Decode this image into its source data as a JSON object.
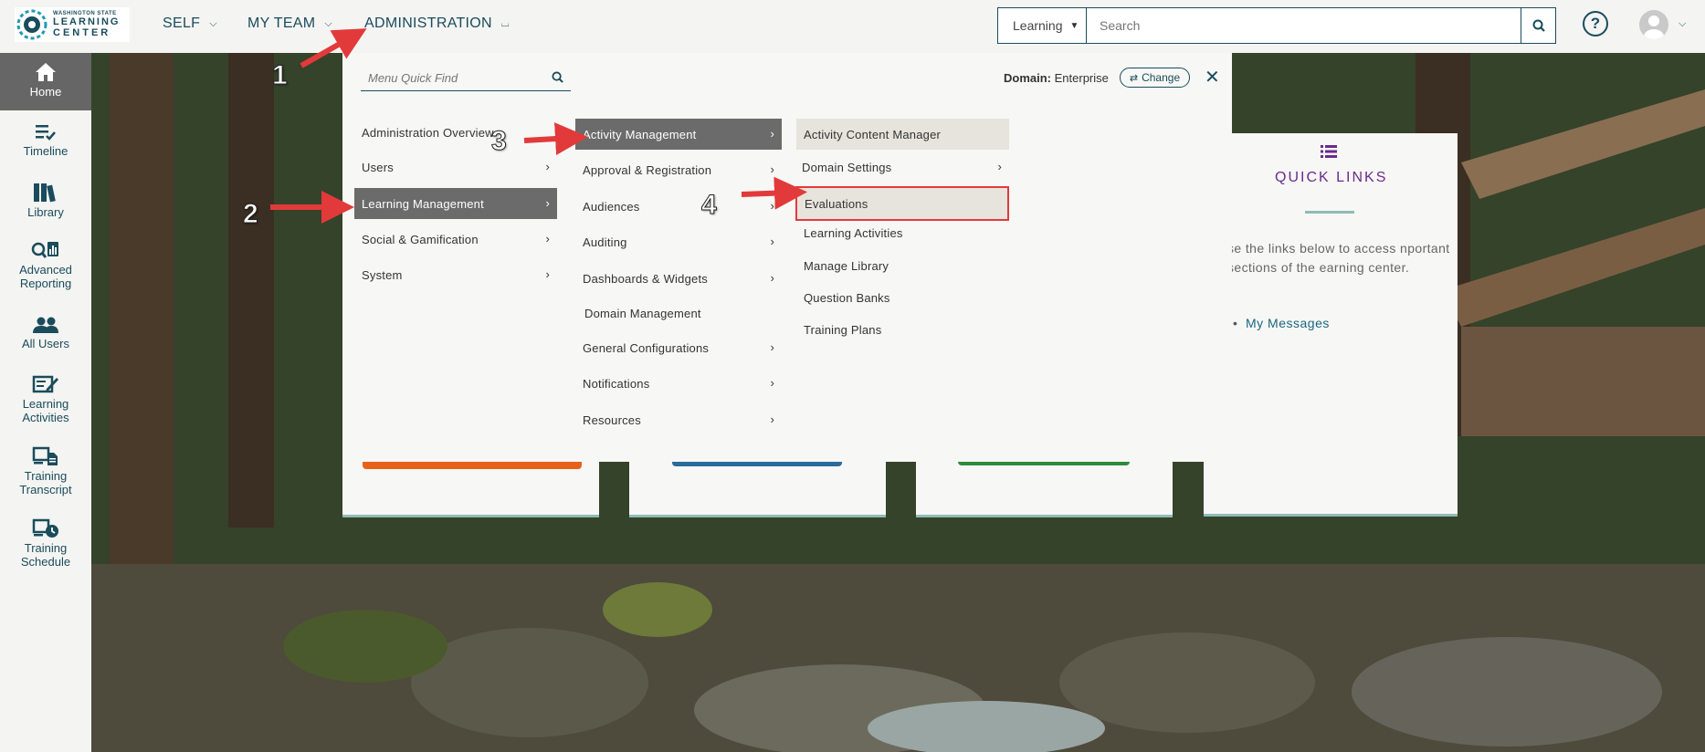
{
  "logo": {
    "line1": "WASHINGTON STATE",
    "line2": "LEARNING",
    "line3": "CENTER"
  },
  "topnav": {
    "self": "SELF",
    "my_team": "MY TEAM",
    "administration": "ADMINISTRATION"
  },
  "search": {
    "type": "Learning",
    "placeholder": "Search"
  },
  "sidebar": {
    "items": [
      {
        "label": "Home",
        "icon": "home-icon"
      },
      {
        "label": "Timeline",
        "icon": "timeline-icon"
      },
      {
        "label": "Library",
        "icon": "library-icon"
      },
      {
        "label": "Advanced Reporting",
        "icon": "reporting-icon"
      },
      {
        "label": "All Users",
        "icon": "users-icon"
      },
      {
        "label": "Learning Activities",
        "icon": "activities-icon"
      },
      {
        "label": "Training Transcript",
        "icon": "transcript-icon"
      },
      {
        "label": "Training Schedule",
        "icon": "schedule-icon"
      }
    ]
  },
  "menu": {
    "quickfind_placeholder": "Menu Quick Find",
    "domain_label": "Domain:",
    "domain_value": "Enterprise",
    "change_label": "Change",
    "col1": [
      "Administration Overview",
      "Users",
      "Learning Management",
      "Social & Gamification",
      "System"
    ],
    "col2": [
      "Activity Management",
      "Approval & Registration",
      "Audiences",
      "Auditing",
      "Dashboards & Widgets",
      "Domain Management",
      "General Configurations",
      "Notifications",
      "Resources"
    ],
    "col3": [
      "Activity Content Manager",
      "Domain Settings",
      "Evaluations",
      "Learning Activities",
      "Manage Library",
      "Question Banks",
      "Training Plans"
    ]
  },
  "quick_links": {
    "title": "QUICK LINKS",
    "description": "se the links below to access nportant sections of the earning center.",
    "link": "My Messages"
  },
  "annotations": {
    "n1": "1",
    "n2": "2",
    "n3": "3",
    "n4": "4"
  },
  "colors": {
    "brand": "#1a4c5c",
    "selected": "#6b6b6b",
    "highlight_box": "#e23a3a",
    "quick_links_title": "#6a2b8e"
  }
}
